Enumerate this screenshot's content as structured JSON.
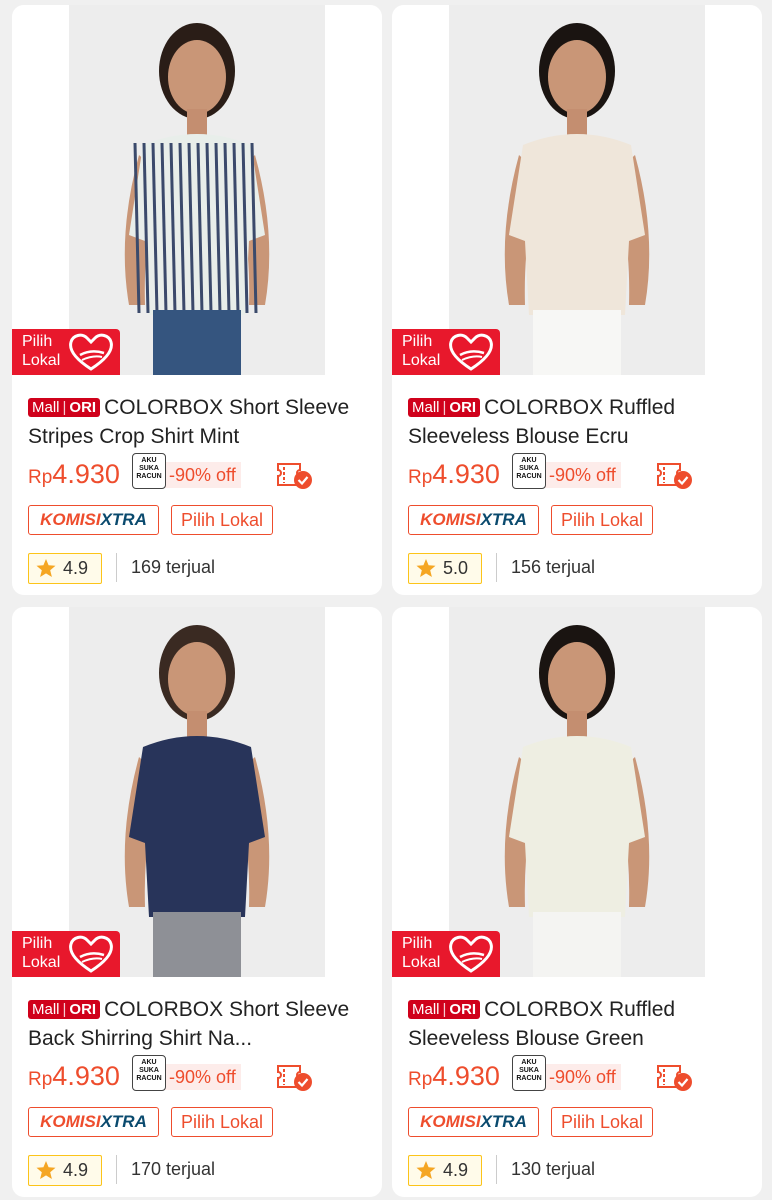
{
  "products": [
    {
      "mall_label": "Mall",
      "ori_label": "ORI",
      "title": "COLORBOX Short Sleeve Stripes Crop Shirt Mint",
      "currency": "Rp",
      "price": "4.930",
      "discount": "-90% off",
      "aku_badge": "AKU SUKA RACUN",
      "komisi_a": "KOMISI",
      "komisi_b": "XTRA",
      "lokal_tag": "Pilih Lokal",
      "pilih_badge": "Pilih Lokal",
      "rating": "4.9",
      "sold": "169 terjual",
      "garment": "stripes"
    },
    {
      "mall_label": "Mall",
      "ori_label": "ORI",
      "title": "COLORBOX Ruffled Sleeveless Blouse Ecru",
      "currency": "Rp",
      "price": "4.930",
      "discount": "-90% off",
      "aku_badge": "AKU SUKA RACUN",
      "komisi_a": "KOMISI",
      "komisi_b": "XTRA",
      "lokal_tag": "Pilih Lokal",
      "pilih_badge": "Pilih Lokal",
      "rating": "5.0",
      "sold": "156 terjual",
      "garment": "ecru"
    },
    {
      "mall_label": "Mall",
      "ori_label": "ORI",
      "title": "COLORBOX Short Sleeve Back Shirring Shirt Na...",
      "currency": "Rp",
      "price": "4.930",
      "discount": "-90% off",
      "aku_badge": "AKU SUKA RACUN",
      "komisi_a": "KOMISI",
      "komisi_b": "XTRA",
      "lokal_tag": "Pilih Lokal",
      "pilih_badge": "Pilih Lokal",
      "rating": "4.9",
      "sold": "170 terjual",
      "garment": "navy"
    },
    {
      "mall_label": "Mall",
      "ori_label": "ORI",
      "title": "COLORBOX Ruffled Sleeveless Blouse Green",
      "currency": "Rp",
      "price": "4.930",
      "discount": "-90% off",
      "aku_badge": "AKU SUKA RACUN",
      "komisi_a": "KOMISI",
      "komisi_b": "XTRA",
      "lokal_tag": "Pilih Lokal",
      "pilih_badge": "Pilih Lokal",
      "rating": "4.9",
      "sold": "130 terjual",
      "garment": "green"
    }
  ],
  "colors": {
    "accent": "#ee4d2d",
    "mall_red": "#d0011b",
    "pilih_red": "#e8182c",
    "rating_yellow": "#fcc419",
    "xtra_blue": "#0a4a6e"
  },
  "icons": {
    "voucher": "voucher-icon",
    "star": "star-icon",
    "heart": "heart-icon"
  }
}
